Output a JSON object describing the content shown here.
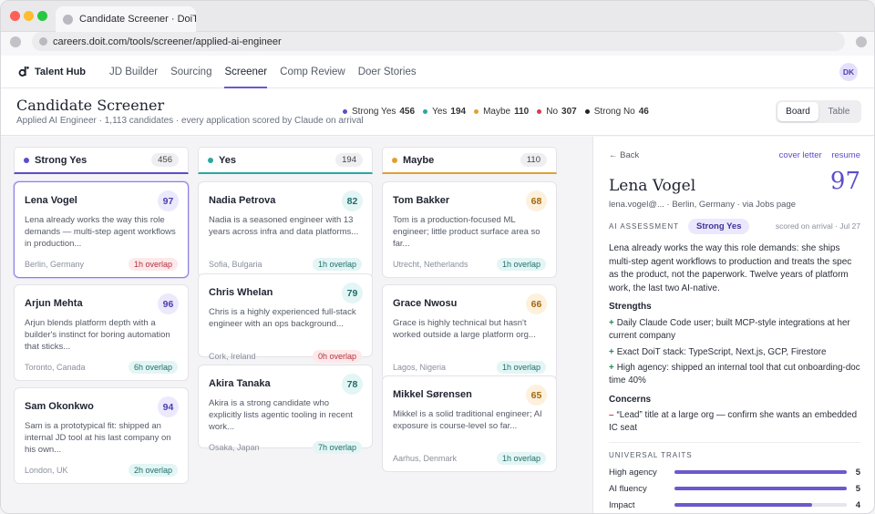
{
  "browser": {
    "tab_title": "Candidate Screener · DoiT T...",
    "url": "careers.doit.com/tools/screener/applied-ai-engineer"
  },
  "nav": {
    "brand": "Talent Hub",
    "links": [
      "JD Builder",
      "Sourcing",
      "Screener",
      "Comp Review",
      "Doer Stories"
    ],
    "active": "Screener",
    "avatar": "DK"
  },
  "header": {
    "title": "Candidate Screener",
    "subtitle": "Applied AI Engineer · 1,113 candidates · every application scored by Claude on arrival",
    "summary": [
      {
        "label": "Strong Yes",
        "count": "456",
        "color": "#5b4ec9"
      },
      {
        "label": "Yes",
        "count": "194",
        "color": "#2aa8a0"
      },
      {
        "label": "Maybe",
        "count": "110",
        "color": "#e0a030"
      },
      {
        "label": "No",
        "count": "307",
        "color": "#d93a4e"
      },
      {
        "label": "Strong No",
        "count": "46",
        "color": "#1f2330"
      }
    ],
    "view_board": "Board",
    "view_table": "Table"
  },
  "columns": [
    {
      "title": "Strong Yes",
      "count": "456",
      "color": "#5b4ec9",
      "cards": [
        {
          "name": "Lena Vogel",
          "score": "97",
          "blurb": "Lena already works the way this role demands — multi-step agent workflows in production...",
          "location": "Berlin, Germany",
          "overlap": "1h overlap",
          "overlap_kind": "red"
        },
        {
          "name": "Arjun Mehta",
          "score": "96",
          "blurb": "Arjun blends platform depth with a builder's instinct for boring automation that sticks...",
          "location": "Toronto, Canada",
          "overlap": "6h overlap",
          "overlap_kind": "teal"
        },
        {
          "name": "Sam Okonkwo",
          "score": "94",
          "blurb": "Sam is a prototypical fit: shipped an internal JD tool at his last company on his own...",
          "location": "London, UK",
          "overlap": "2h overlap",
          "overlap_kind": "teal"
        }
      ]
    },
    {
      "title": "Yes",
      "count": "194",
      "color": "#2aa8a0",
      "cards": [
        {
          "name": "Nadia Petrova",
          "score": "82",
          "blurb": "Nadia is a seasoned engineer with 13 years across infra and data platforms...",
          "location": "Sofia, Bulgaria",
          "overlap": "1h overlap",
          "overlap_kind": "teal"
        },
        {
          "name": "Chris Whelan",
          "score": "79",
          "blurb": "Chris is a highly experienced full-stack engineer with an ops background...",
          "location": "Cork, Ireland",
          "overlap": "0h overlap",
          "overlap_kind": "red"
        },
        {
          "name": "Akira Tanaka",
          "score": "78",
          "blurb": "Akira is a strong candidate who explicitly lists agentic tooling in recent work...",
          "location": "Osaka, Japan",
          "overlap": "7h overlap",
          "overlap_kind": "teal"
        }
      ]
    },
    {
      "title": "Maybe",
      "count": "110",
      "color": "#e0a030",
      "cards": [
        {
          "name": "Tom Bakker",
          "score": "68",
          "blurb": "Tom is a production-focused ML engineer; little product surface area so far...",
          "location": "Utrecht, Netherlands",
          "overlap": "1h overlap",
          "overlap_kind": "teal"
        },
        {
          "name": "Grace Nwosu",
          "score": "66",
          "blurb": "Grace is highly technical but hasn't worked outside a large platform org...",
          "location": "Lagos, Nigeria",
          "overlap": "1h overlap",
          "overlap_kind": "teal"
        },
        {
          "name": "Mikkel Sørensen",
          "score": "65",
          "blurb": "Mikkel is a solid traditional engineer; AI exposure is course-level so far...",
          "location": "Aarhus, Denmark",
          "overlap": "1h overlap",
          "overlap_kind": "teal"
        }
      ]
    }
  ],
  "detail": {
    "back": "← Back",
    "cover_letter": "cover letter",
    "resume": "resume",
    "name": "Lena Vogel",
    "score": "97",
    "meta": "lena.vogel@... · Berlin, Germany · via Jobs page",
    "assessment_label": "AI ASSESSMENT",
    "assessment": "Strong Yes",
    "scored": "scored on arrival · Jul 27",
    "summary": "Lena already works the way this role demands: she ships multi-step agent workflows to production and treats the spec as the product, not the paperwork. Twelve years of platform work, the last two AI-native.",
    "strengths_title": "Strengths",
    "strengths": [
      "Daily Claude Code user; built MCP-style integrations at her current company",
      "Exact DoiT stack: TypeScript, Next.js, GCP, Firestore",
      "High agency: shipped an internal tool that cut onboarding-doc time 40%"
    ],
    "concerns_title": "Concerns",
    "concerns": [
      "“Lead” title at a large org — confirm she wants an embedded IC seat"
    ],
    "traits_title": "UNIVERSAL TRAITS",
    "traits": [
      {
        "label": "High agency",
        "value": "5",
        "fraction": 1.0
      },
      {
        "label": "AI fluency",
        "value": "5",
        "fraction": 1.0
      },
      {
        "label": "Impact",
        "value": "4",
        "fraction": 0.8
      }
    ]
  }
}
